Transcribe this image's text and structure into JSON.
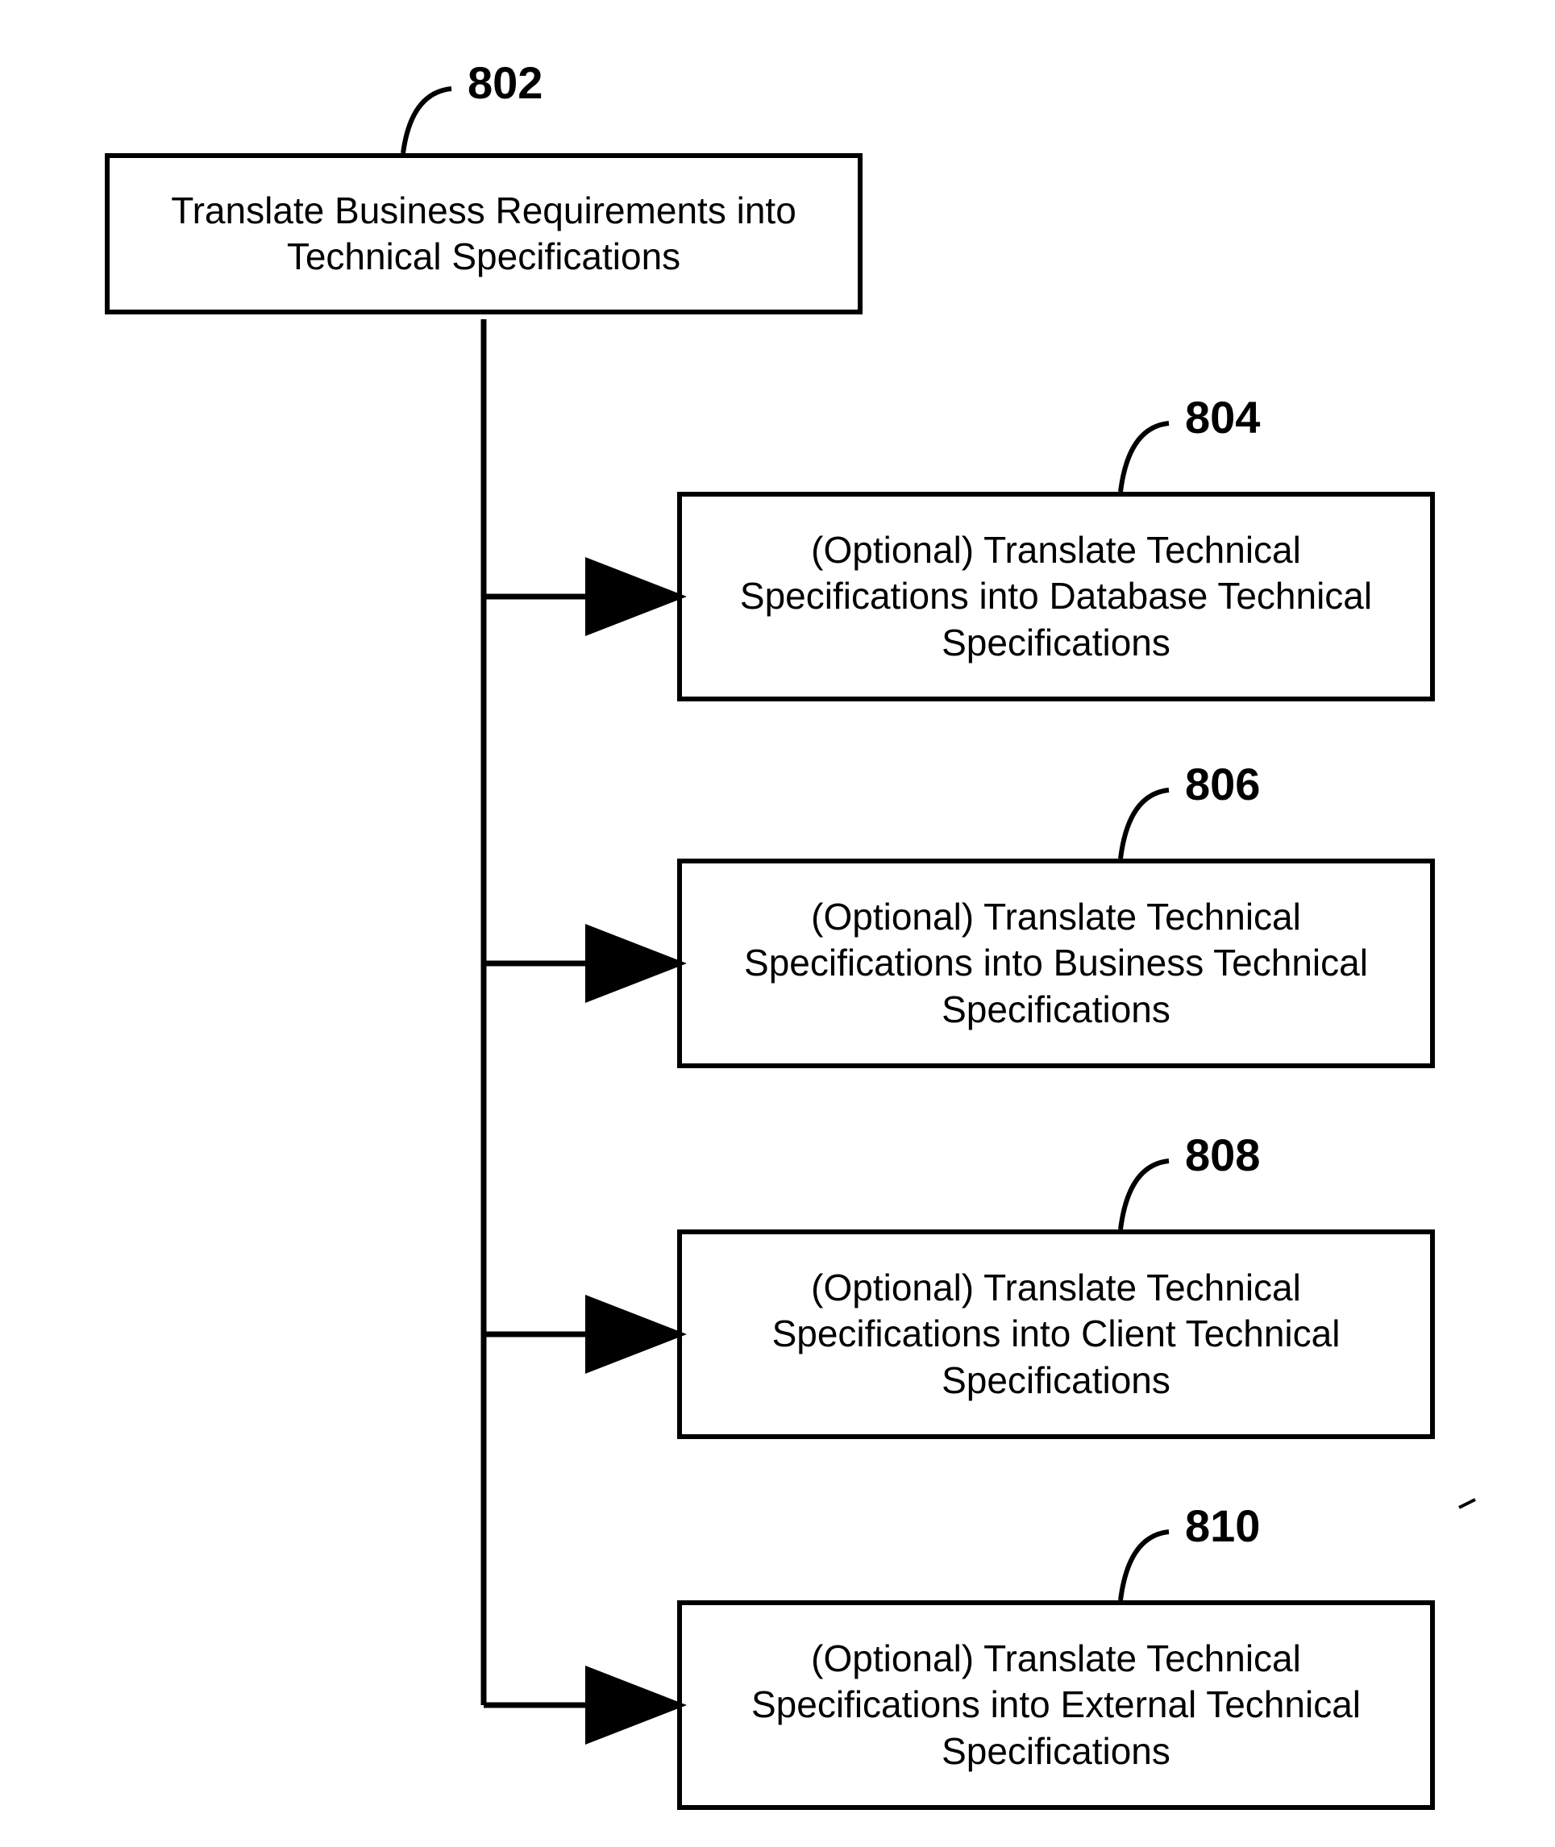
{
  "labels": {
    "n802": "802",
    "n804": "804",
    "n806": "806",
    "n808": "808",
    "n810": "810"
  },
  "boxes": {
    "b802": "Translate Business Requirements into Technical Specifications",
    "b804": "(Optional) Translate Technical Specifications into Database Technical Specifications",
    "b806": "(Optional) Translate Technical Specifications into Business Technical Specifications",
    "b808": "(Optional) Translate Technical Specifications into Client Technical Specifications",
    "b810": "(Optional) Translate Technical Specifications into External Technical Specifications"
  }
}
